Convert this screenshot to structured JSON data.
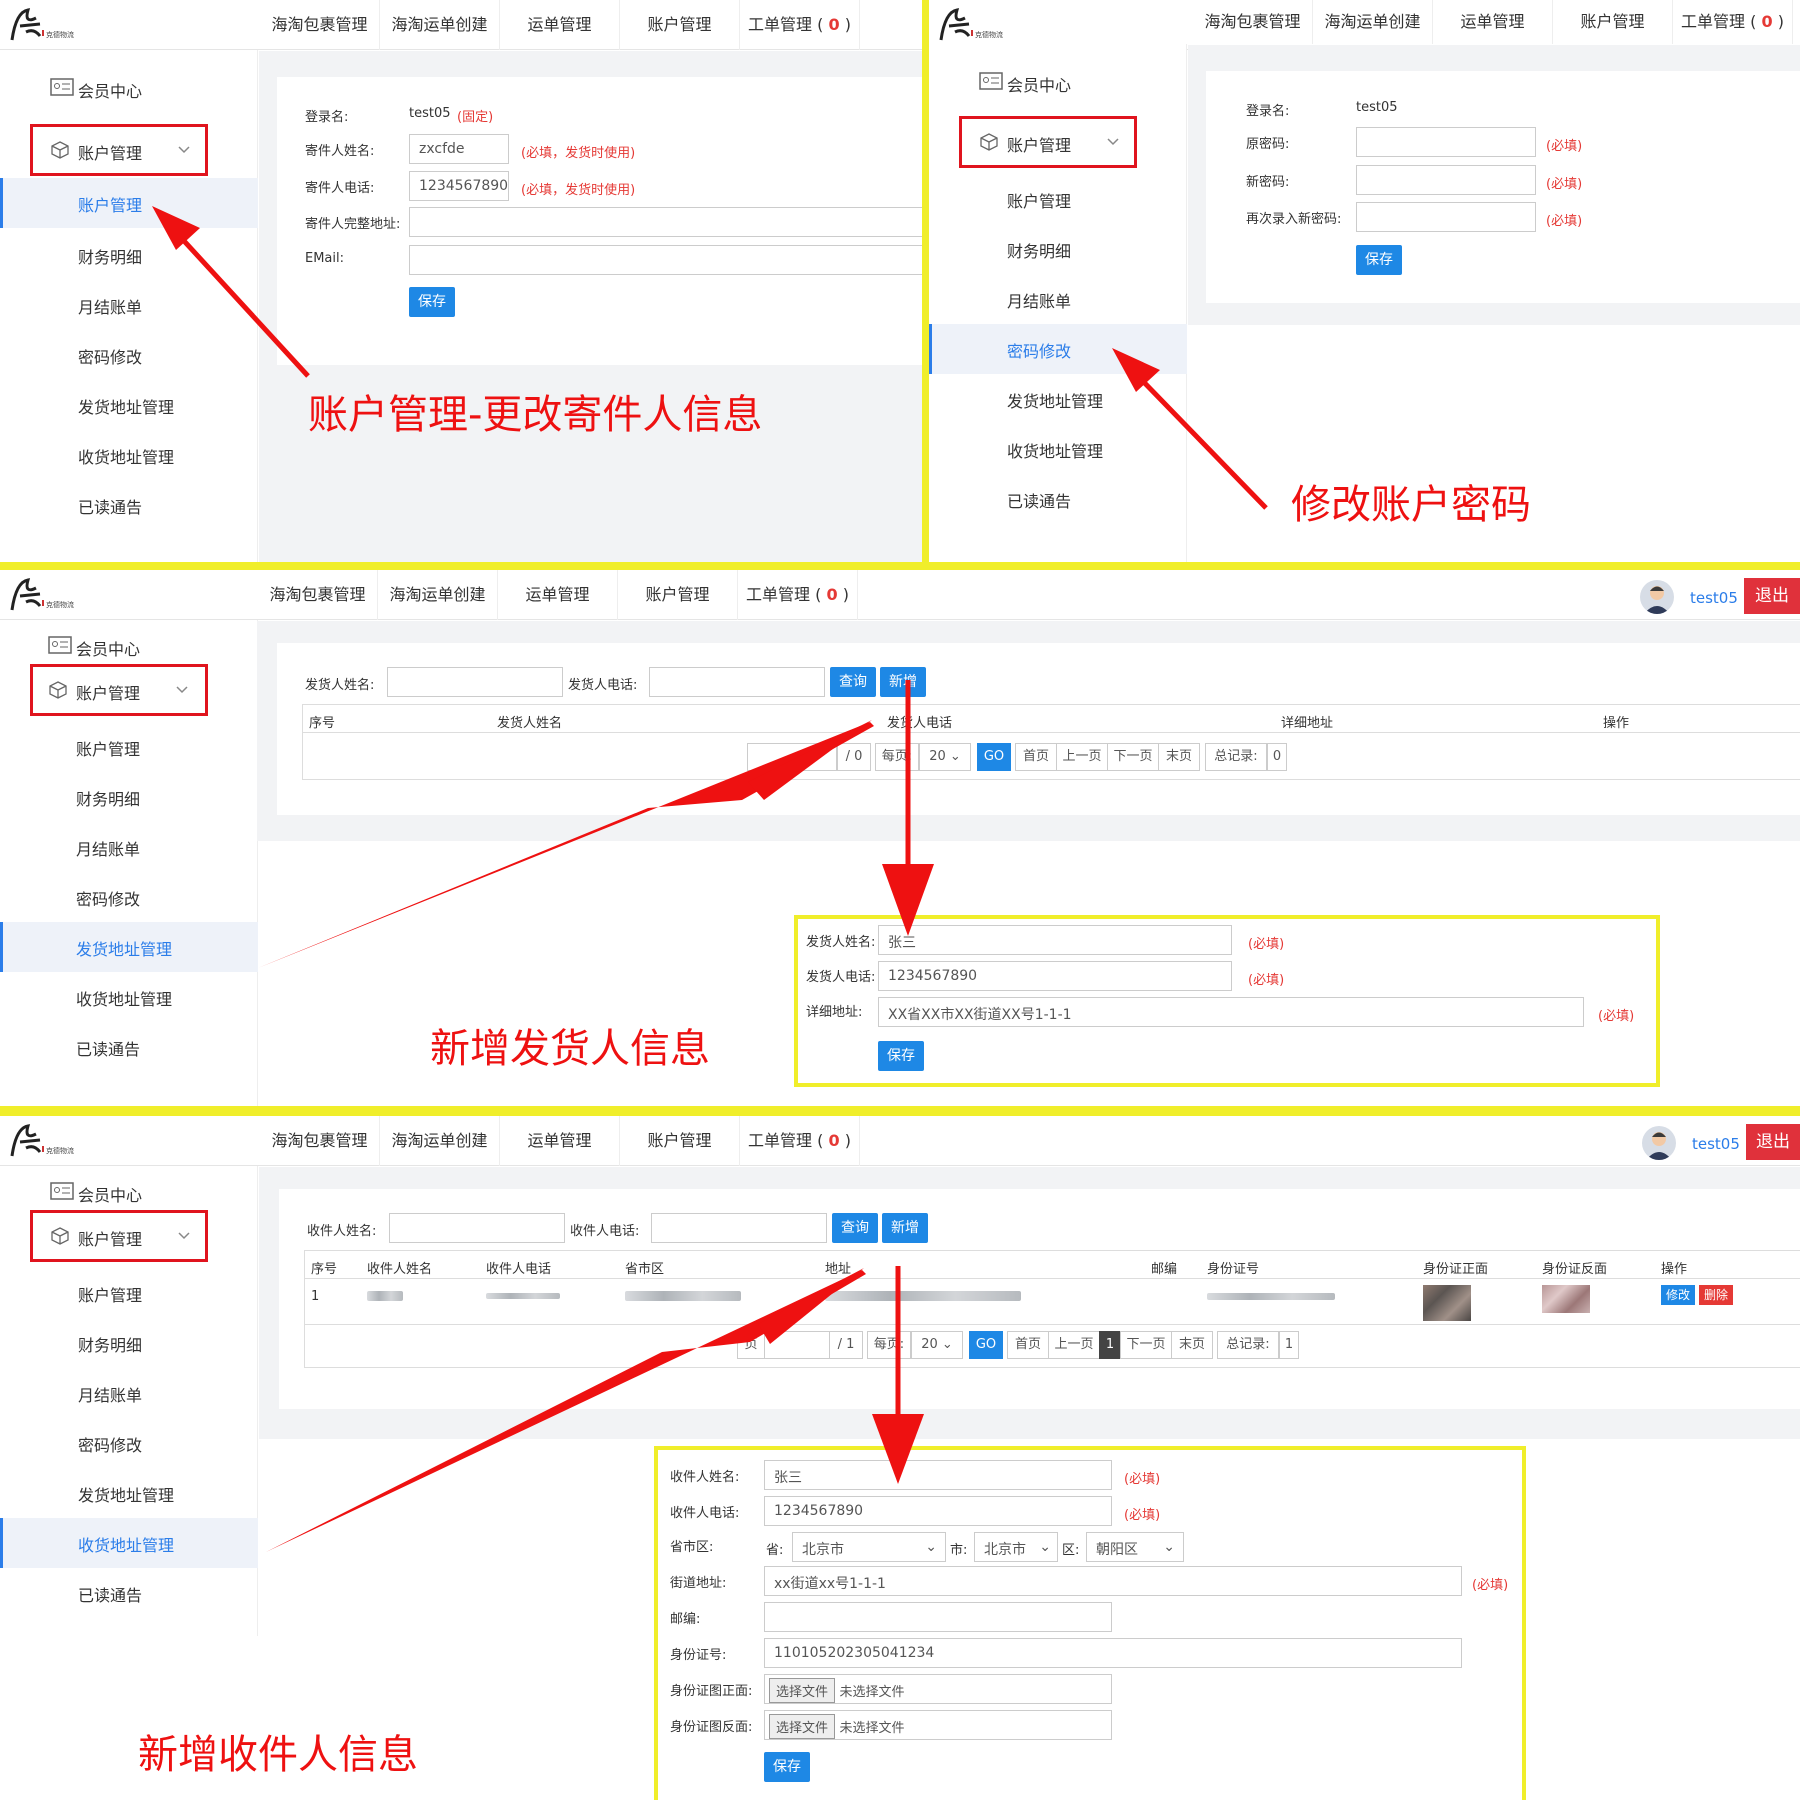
{
  "nav": {
    "items": [
      "海淘包裹管理",
      "海淘运单创建",
      "运单管理",
      "账户管理"
    ],
    "ticket_label": "工单管理",
    "ticket_count": "0"
  },
  "sidebar": {
    "member": "会员中心",
    "group": "账户管理",
    "items": [
      "账户管理",
      "财务明细",
      "月结账单",
      "密码修改",
      "发货地址管理",
      "收货地址管理",
      "已读通告"
    ]
  },
  "user": {
    "name": "test05",
    "logout": "退出"
  },
  "panel1": {
    "login_label": "登录名:",
    "login_value": "test05",
    "login_fixed": "(固定)",
    "sender_name_label": "寄件人姓名:",
    "sender_name_value": "zxcfde",
    "sender_name_req": "(必填，发货时使用)",
    "sender_phone_label": "寄件人电话:",
    "sender_phone_value": "1234567890",
    "sender_phone_req": "(必填，发货时使用)",
    "address_label": "寄件人完整地址:",
    "email_label": "EMail:",
    "save": "保存",
    "annotation": "账户管理-更改寄件人信息"
  },
  "panel2": {
    "login_label": "登录名:",
    "login_value": "test05",
    "old_pwd_label": "原密码:",
    "new_pwd_label": "新密码:",
    "re_pwd_label": "再次录入新密码:",
    "req": "(必填)",
    "save": "保存",
    "annotation": "修改账户密码"
  },
  "panel3": {
    "search_name_label": "发货人姓名:",
    "search_phone_label": "发货人电话:",
    "query": "查询",
    "add": "新增",
    "headers": [
      "序号",
      "发货人姓名",
      "发货人电话",
      "详细地址",
      "操作"
    ],
    "pager": {
      "page_of": "/ 0",
      "per_page": "每页:",
      "per_page_value": "20",
      "go": "GO",
      "first": "首页",
      "prev": "上一页",
      "next": "下一页",
      "last": "末页",
      "total_label": "总记录:",
      "total": "0"
    },
    "form": {
      "name_label": "发货人姓名:",
      "name_value": "张三",
      "phone_label": "发货人电话:",
      "phone_value": "1234567890",
      "addr_label": "详细地址:",
      "addr_value": "XX省XX市XX街道XX号1-1-1",
      "req": "(必填)",
      "save": "保存"
    },
    "annotation": "新增发货人信息"
  },
  "panel4": {
    "search_name_label": "收件人姓名:",
    "search_phone_label": "收件人电话:",
    "query": "查询",
    "add": "新增",
    "headers": [
      "序号",
      "收件人姓名",
      "收件人电话",
      "省市区",
      "地址",
      "邮编",
      "身份证号",
      "身份证正面",
      "身份证反面",
      "操作"
    ],
    "row": {
      "index": "1",
      "edit": "修改",
      "delete": "删除"
    },
    "pager": {
      "page_label": "页",
      "page_of": "/ 1",
      "per_page": "每页:",
      "per_page_value": "20",
      "go": "GO",
      "first": "首页",
      "prev": "上一页",
      "current": "1",
      "next": "下一页",
      "last": "末页",
      "total_label": "总记录:",
      "total": "1"
    },
    "form": {
      "name_label": "收件人姓名:",
      "name_value": "张三",
      "phone_label": "收件人电话:",
      "phone_value": "1234567890",
      "region_label": "省市区:",
      "prov_label": "省:",
      "prov_value": "北京市",
      "city_label": "市:",
      "city_value": "北京市",
      "district_label": "区:",
      "district_value": "朝阳区",
      "street_label": "街道地址:",
      "street_value": "xx街道xx号1-1-1",
      "zip_label": "邮编:",
      "id_label": "身份证号:",
      "id_value": "110105202305041234",
      "front_label": "身份证图正面:",
      "back_label": "身份证图反面:",
      "choose": "选择文件",
      "no_file": "未选择文件",
      "req": "(必填)",
      "save": "保存"
    },
    "annotation": "新增收件人信息"
  },
  "colors": {
    "accent": "#1e88e5",
    "required": "#e53935",
    "annotation": "#ee1111",
    "highlight": "#f0ee2a"
  }
}
